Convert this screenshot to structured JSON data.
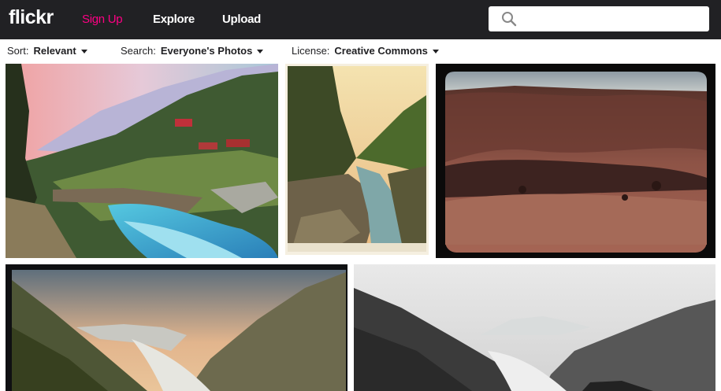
{
  "header": {
    "logo": "flickr",
    "nav": [
      "Sign Up",
      "Explore",
      "Upload"
    ],
    "search_placeholder": ""
  },
  "filters": {
    "sort": {
      "label": "Sort:",
      "value": "Relevant"
    },
    "search": {
      "label": "Search:",
      "value": "Everyone's Photos"
    },
    "license": {
      "label": "License:",
      "value": "Creative Commons"
    }
  },
  "colors": {
    "topbar": "#212124",
    "brand_pink": "#ff0084"
  },
  "photos": [
    {
      "subject": "hand-colored mountain valley with river and bridge"
    },
    {
      "subject": "hand-colored gorge with river and rocks"
    },
    {
      "subject": "reddish eroded hillside landscape"
    },
    {
      "subject": "hand-colored glacier valley between mountains"
    },
    {
      "subject": "black and white glacier valley"
    }
  ]
}
